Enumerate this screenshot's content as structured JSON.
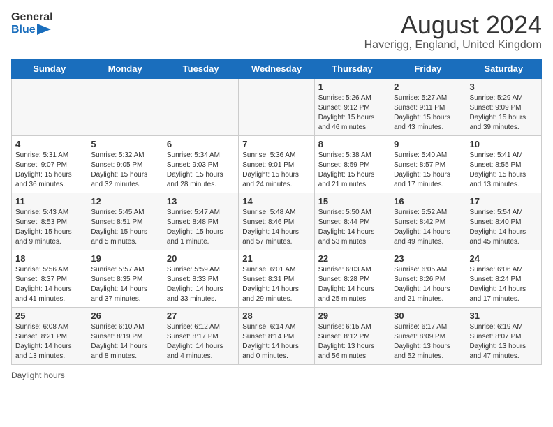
{
  "header": {
    "logo_line1": "General",
    "logo_line2": "Blue",
    "month_title": "August 2024",
    "subtitle": "Haverigg, England, United Kingdom"
  },
  "days_of_week": [
    "Sunday",
    "Monday",
    "Tuesday",
    "Wednesday",
    "Thursday",
    "Friday",
    "Saturday"
  ],
  "weeks": [
    [
      {
        "day": "",
        "info": ""
      },
      {
        "day": "",
        "info": ""
      },
      {
        "day": "",
        "info": ""
      },
      {
        "day": "",
        "info": ""
      },
      {
        "day": "1",
        "info": "Sunrise: 5:26 AM\nSunset: 9:12 PM\nDaylight: 15 hours\nand 46 minutes."
      },
      {
        "day": "2",
        "info": "Sunrise: 5:27 AM\nSunset: 9:11 PM\nDaylight: 15 hours\nand 43 minutes."
      },
      {
        "day": "3",
        "info": "Sunrise: 5:29 AM\nSunset: 9:09 PM\nDaylight: 15 hours\nand 39 minutes."
      }
    ],
    [
      {
        "day": "4",
        "info": "Sunrise: 5:31 AM\nSunset: 9:07 PM\nDaylight: 15 hours\nand 36 minutes."
      },
      {
        "day": "5",
        "info": "Sunrise: 5:32 AM\nSunset: 9:05 PM\nDaylight: 15 hours\nand 32 minutes."
      },
      {
        "day": "6",
        "info": "Sunrise: 5:34 AM\nSunset: 9:03 PM\nDaylight: 15 hours\nand 28 minutes."
      },
      {
        "day": "7",
        "info": "Sunrise: 5:36 AM\nSunset: 9:01 PM\nDaylight: 15 hours\nand 24 minutes."
      },
      {
        "day": "8",
        "info": "Sunrise: 5:38 AM\nSunset: 8:59 PM\nDaylight: 15 hours\nand 21 minutes."
      },
      {
        "day": "9",
        "info": "Sunrise: 5:40 AM\nSunset: 8:57 PM\nDaylight: 15 hours\nand 17 minutes."
      },
      {
        "day": "10",
        "info": "Sunrise: 5:41 AM\nSunset: 8:55 PM\nDaylight: 15 hours\nand 13 minutes."
      }
    ],
    [
      {
        "day": "11",
        "info": "Sunrise: 5:43 AM\nSunset: 8:53 PM\nDaylight: 15 hours\nand 9 minutes."
      },
      {
        "day": "12",
        "info": "Sunrise: 5:45 AM\nSunset: 8:51 PM\nDaylight: 15 hours\nand 5 minutes."
      },
      {
        "day": "13",
        "info": "Sunrise: 5:47 AM\nSunset: 8:48 PM\nDaylight: 15 hours\nand 1 minute."
      },
      {
        "day": "14",
        "info": "Sunrise: 5:48 AM\nSunset: 8:46 PM\nDaylight: 14 hours\nand 57 minutes."
      },
      {
        "day": "15",
        "info": "Sunrise: 5:50 AM\nSunset: 8:44 PM\nDaylight: 14 hours\nand 53 minutes."
      },
      {
        "day": "16",
        "info": "Sunrise: 5:52 AM\nSunset: 8:42 PM\nDaylight: 14 hours\nand 49 minutes."
      },
      {
        "day": "17",
        "info": "Sunrise: 5:54 AM\nSunset: 8:40 PM\nDaylight: 14 hours\nand 45 minutes."
      }
    ],
    [
      {
        "day": "18",
        "info": "Sunrise: 5:56 AM\nSunset: 8:37 PM\nDaylight: 14 hours\nand 41 minutes."
      },
      {
        "day": "19",
        "info": "Sunrise: 5:57 AM\nSunset: 8:35 PM\nDaylight: 14 hours\nand 37 minutes."
      },
      {
        "day": "20",
        "info": "Sunrise: 5:59 AM\nSunset: 8:33 PM\nDaylight: 14 hours\nand 33 minutes."
      },
      {
        "day": "21",
        "info": "Sunrise: 6:01 AM\nSunset: 8:31 PM\nDaylight: 14 hours\nand 29 minutes."
      },
      {
        "day": "22",
        "info": "Sunrise: 6:03 AM\nSunset: 8:28 PM\nDaylight: 14 hours\nand 25 minutes."
      },
      {
        "day": "23",
        "info": "Sunrise: 6:05 AM\nSunset: 8:26 PM\nDaylight: 14 hours\nand 21 minutes."
      },
      {
        "day": "24",
        "info": "Sunrise: 6:06 AM\nSunset: 8:24 PM\nDaylight: 14 hours\nand 17 minutes."
      }
    ],
    [
      {
        "day": "25",
        "info": "Sunrise: 6:08 AM\nSunset: 8:21 PM\nDaylight: 14 hours\nand 13 minutes."
      },
      {
        "day": "26",
        "info": "Sunrise: 6:10 AM\nSunset: 8:19 PM\nDaylight: 14 hours\nand 8 minutes."
      },
      {
        "day": "27",
        "info": "Sunrise: 6:12 AM\nSunset: 8:17 PM\nDaylight: 14 hours\nand 4 minutes."
      },
      {
        "day": "28",
        "info": "Sunrise: 6:14 AM\nSunset: 8:14 PM\nDaylight: 14 hours\nand 0 minutes."
      },
      {
        "day": "29",
        "info": "Sunrise: 6:15 AM\nSunset: 8:12 PM\nDaylight: 13 hours\nand 56 minutes."
      },
      {
        "day": "30",
        "info": "Sunrise: 6:17 AM\nSunset: 8:09 PM\nDaylight: 13 hours\nand 52 minutes."
      },
      {
        "day": "31",
        "info": "Sunrise: 6:19 AM\nSunset: 8:07 PM\nDaylight: 13 hours\nand 47 minutes."
      }
    ]
  ],
  "footer": {
    "note": "Daylight hours"
  },
  "colors": {
    "header_bg": "#1a6ebd",
    "accent": "#1a6ebd"
  }
}
